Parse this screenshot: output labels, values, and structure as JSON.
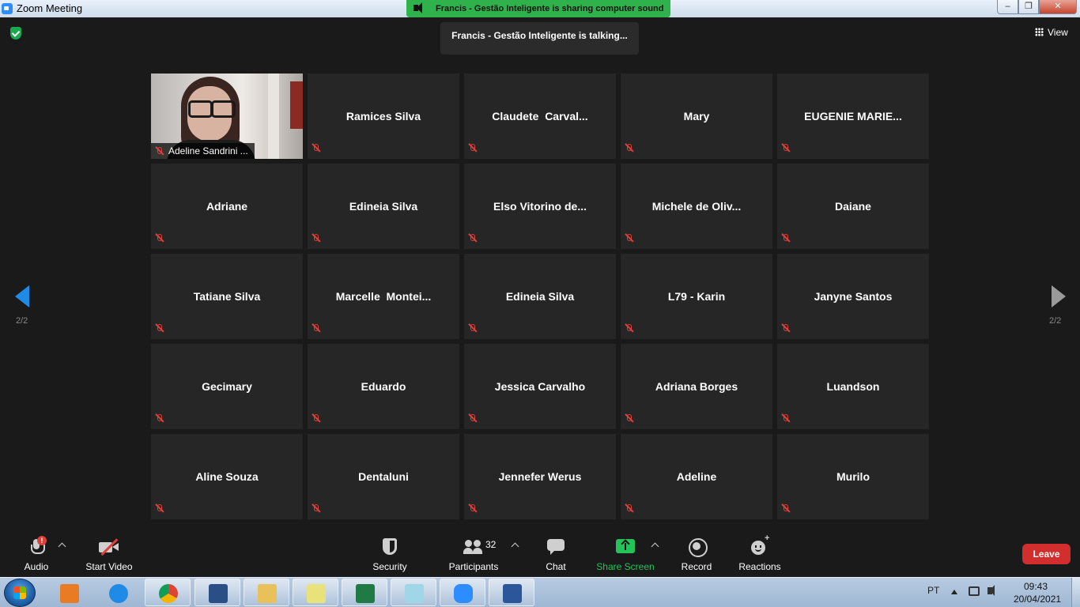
{
  "window": {
    "title": "Zoom Meeting"
  },
  "banner": {
    "sharing": "Francis - Gestão Inteligente is sharing computer sound",
    "talking": "Francis - Gestão Inteligente is talking..."
  },
  "view_label": "View",
  "pager": {
    "left_label": "2/2",
    "right_label": "2/2"
  },
  "video_tile": {
    "name": "Adeline Sandrini ..."
  },
  "participants": [
    "Ramices Silva",
    "Claudete  Carval...",
    "Mary",
    "EUGENIE MARIE...",
    "Adriane",
    "Edineia Silva",
    "Elso Vitorino de...",
    "Michele de Oliv...",
    "Daiane",
    "Tatiane Silva",
    "Marcelle  Montei...",
    "Edineia Silva",
    "L79 - Karin",
    "Janyne Santos",
    "Gecimary",
    "Eduardo",
    "Jessica Carvalho",
    "Adriana Borges",
    "Luandson",
    "Aline Souza",
    "Dentaluni",
    "Jennefer Werus",
    "Adeline",
    "Murilo"
  ],
  "controls": {
    "audio": "Audio",
    "audio_alert": "!",
    "video": "Start Video",
    "security": "Security",
    "participants": "Participants",
    "participants_count": "32",
    "chat": "Chat",
    "share": "Share Screen",
    "record": "Record",
    "reactions": "Reactions",
    "leave": "Leave"
  },
  "taskbar": {
    "apps": [
      "media-player-icon",
      "internet-explorer-icon",
      "chrome-icon",
      "remote-desktop-icon",
      "file-explorer-icon",
      "sticky-notes-icon",
      "excel-icon",
      "notepad-icon",
      "zoom-icon",
      "word-icon"
    ],
    "language": "PT",
    "time": "09:43",
    "date": "20/04/2021"
  },
  "colors": {
    "accent_blue": "#1f8be6",
    "banner_green": "#2fb24c",
    "share_green": "#23c35a",
    "mute_red": "#e0403a",
    "leave_red": "#d22e2e"
  }
}
